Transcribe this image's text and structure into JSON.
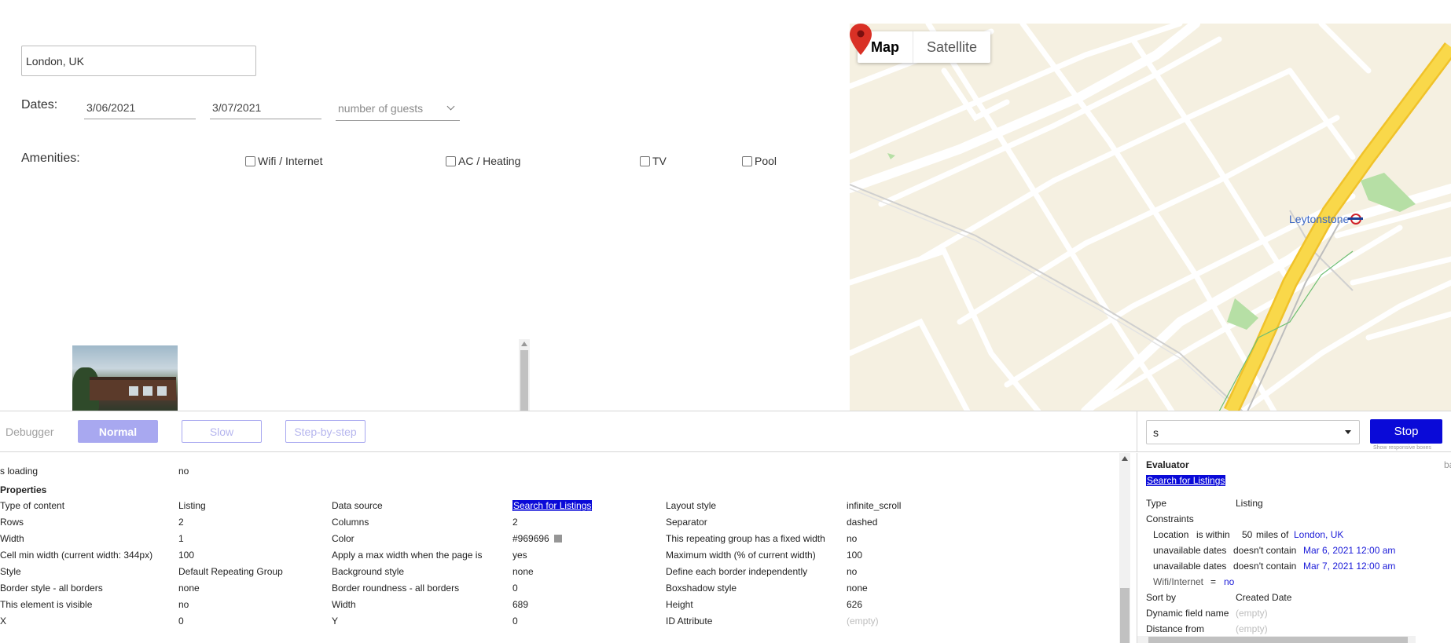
{
  "search": {
    "location_value": "London, UK",
    "dates_label": "Dates:",
    "check_in": "3/06/2021",
    "check_out": "3/07/2021",
    "guests_placeholder": "number of guests",
    "amenities_label": "Amenities:",
    "amenities": [
      "Wifi / Internet",
      "AC / Heating",
      "TV",
      "Pool"
    ]
  },
  "map": {
    "type_options": [
      "Map",
      "Satellite"
    ],
    "selected_type": "Map",
    "station_name": "Leytonstone"
  },
  "debugger": {
    "title": "Debugger",
    "modes": [
      "Normal",
      "Slow",
      "Step-by-step"
    ],
    "active_mode": "Normal",
    "element_select_value": "s",
    "stop_label": "Stop",
    "responsive_hint": "Show responsive boxes",
    "loading_label": "s loading",
    "loading_value": "no",
    "properties_title": "Properties",
    "properties": [
      [
        [
          "Type of content",
          "Listing"
        ],
        [
          "Data source",
          "Search for Listings"
        ],
        [
          "Layout style",
          "infinite_scroll"
        ]
      ],
      [
        [
          "Rows",
          "2"
        ],
        [
          "Columns",
          "2"
        ],
        [
          "Separator",
          "dashed"
        ]
      ],
      [
        [
          "Width",
          "1"
        ],
        [
          "Color",
          "#969696"
        ],
        [
          "This repeating group has a fixed width",
          "no"
        ]
      ],
      [
        [
          "Cell min width (current width: 344px)",
          "100"
        ],
        [
          "Apply a max width when the page is",
          "yes"
        ],
        [
          "Maximum width (% of current width)",
          "100"
        ]
      ],
      [
        [
          "Style",
          "Default Repeating Group"
        ],
        [
          "Background style",
          "none"
        ],
        [
          "Define each border independently",
          "no"
        ]
      ],
      [
        [
          "Border style - all borders",
          "none"
        ],
        [
          "Border roundness - all borders",
          "0"
        ],
        [
          "Boxshadow style",
          "none"
        ]
      ],
      [
        [
          "This element is visible",
          "no"
        ],
        [
          "Width",
          "689"
        ],
        [
          "Height",
          "626"
        ]
      ],
      [
        [
          "X",
          "0"
        ],
        [
          "Y",
          "0"
        ],
        [
          "ID Attribute",
          "(empty)"
        ]
      ]
    ],
    "evaluator": {
      "title": "Evaluator",
      "cut_label": "ba",
      "expression": "Search for Listings",
      "type_label": "Type",
      "type_value": "Listing",
      "constraints_label": "Constraints",
      "constraints": [
        {
          "field": "Location",
          "op": "is within",
          "value": "50",
          "unit": "miles of",
          "target": "London, UK"
        },
        {
          "field": "unavailable dates",
          "op": "doesn't contain",
          "target": "Mar 6, 2021 12:00 am"
        },
        {
          "field": "unavailable dates",
          "op": "doesn't contain",
          "target": "Mar 7, 2021 12:00 am"
        },
        {
          "field": "Wifi/Internet",
          "op": "=",
          "target": "no"
        }
      ],
      "sort_by_label": "Sort by",
      "sort_by_value": "Created Date",
      "dynamic_field_label": "Dynamic field name",
      "dynamic_field_value": "(empty)",
      "distance_label": "Distance from",
      "distance_value": "(empty)"
    }
  },
  "colors": {
    "accent": "#0a0ad8",
    "normal_mode": "#a8a8f0",
    "map_land": "#f5f0e1",
    "highway": "#f9d84a",
    "station": "#3a66c4",
    "pin": "#d93025"
  }
}
